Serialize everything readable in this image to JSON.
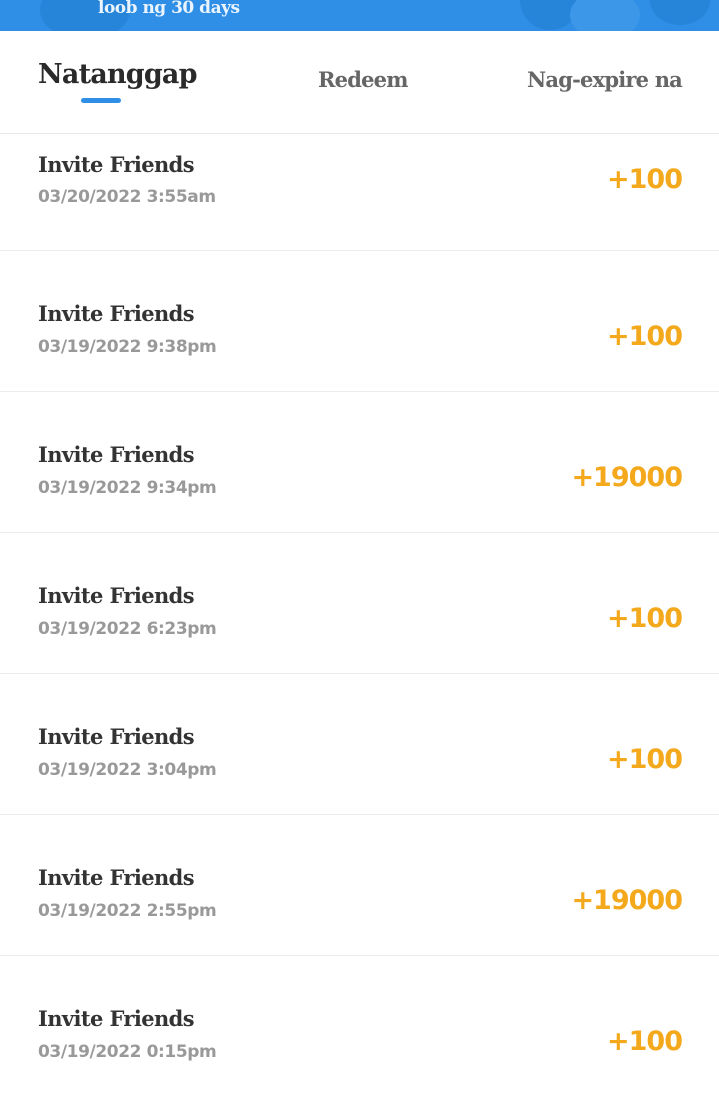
{
  "banner": {
    "text": "loob ng 30 days"
  },
  "tabs": [
    {
      "label": "Natanggap",
      "active": true
    },
    {
      "label": "Redeem",
      "active": false
    },
    {
      "label": "Nag-expire na",
      "active": false
    }
  ],
  "colors": {
    "accent": "#2f8fe6",
    "points": "#f4a81c"
  },
  "entries": [
    {
      "title": "Invite Friends",
      "date": "03/20/2022 3:55am",
      "points": "+100"
    },
    {
      "title": "Invite Friends",
      "date": "03/19/2022 9:38pm",
      "points": "+100"
    },
    {
      "title": "Invite Friends",
      "date": "03/19/2022 9:34pm",
      "points": "+19000"
    },
    {
      "title": "Invite Friends",
      "date": "03/19/2022 6:23pm",
      "points": "+100"
    },
    {
      "title": "Invite Friends",
      "date": "03/19/2022 3:04pm",
      "points": "+100"
    },
    {
      "title": "Invite Friends",
      "date": "03/19/2022 2:55pm",
      "points": "+19000"
    },
    {
      "title": "Invite Friends",
      "date": "03/19/2022 0:15pm",
      "points": "+100"
    }
  ]
}
